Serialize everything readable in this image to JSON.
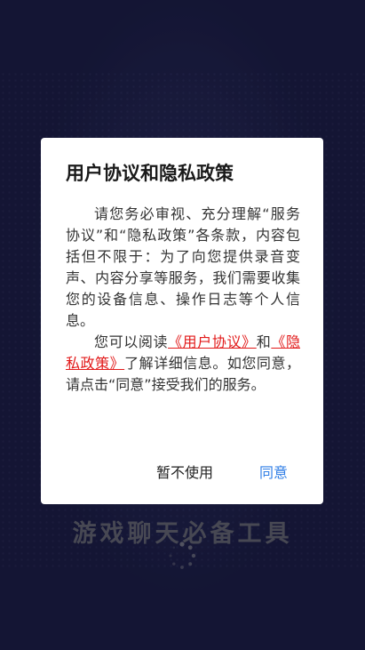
{
  "background": {
    "slogan": "游戏聊天必备工具",
    "slogan_color": "#6e6f80",
    "bg_color": "#1f2150"
  },
  "dialog": {
    "title": "用户协议和隐私政策",
    "paragraph1": "请您务必审视、充分理解“服务协议”和“隐私政策”各条款，内容包括但不限于：为了向您提供录音变声、内容分享等服务，我们需要收集您的设备信息、操作日志等个人信息。",
    "paragraph2_before": "您可以阅读",
    "link_user_agreement": "《用户协议》",
    "paragraph2_and": "和",
    "link_privacy_policy": "《隐私政策》",
    "paragraph2_after": "了解详细信息。如您同意，请点击“同意”接受我们的服务。",
    "decline_label": "暂不使用",
    "agree_label": "同意",
    "link_color": "#e21a1a",
    "agree_color": "#2f7ee6"
  },
  "icons": {
    "spinner": "loading-spinner-icon"
  }
}
